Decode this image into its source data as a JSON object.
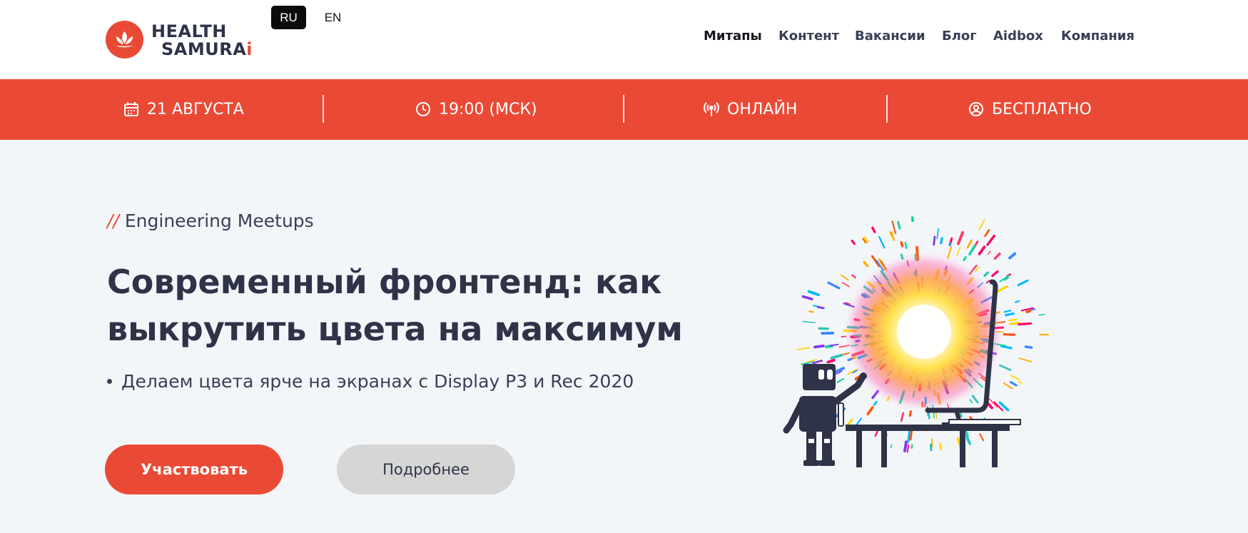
{
  "header": {
    "logo": {
      "line1": "HEALTH",
      "line2_main": "SAMURA",
      "line2_accent": "i"
    },
    "languages": [
      {
        "label": "RU",
        "active": true
      },
      {
        "label": "EN",
        "active": false
      }
    ],
    "nav": [
      {
        "label": "Митапы",
        "active": true
      },
      {
        "label": "Контент",
        "active": false
      },
      {
        "label": "Вакансии",
        "active": false
      },
      {
        "label": "Блог",
        "active": false
      },
      {
        "label": "Aidbox",
        "active": false
      },
      {
        "label": "Компания",
        "active": false
      }
    ]
  },
  "infobar": {
    "date": {
      "icon": "calendar-icon",
      "label": "21 АВГУСТА"
    },
    "time": {
      "icon": "clock-icon",
      "label": "19:00 (МСК)"
    },
    "format": {
      "icon": "broadcast-icon",
      "label": "ОНЛАЙН"
    },
    "price": {
      "icon": "user-circle-icon",
      "label": "БЕСПЛАТНО"
    }
  },
  "hero": {
    "eyebrow_mark": "//",
    "eyebrow": "Engineering Meetups",
    "title_line1": "Современный фронтенд: как",
    "title_line2": "выкрутить цвета на максимум",
    "bullets": [
      "Делаем цвета ярче на экранах с Display P3 и Rec 2020"
    ],
    "primary_button": "Участвовать",
    "secondary_button": "Подробнее",
    "illustration": "robot-pointing-at-colorful-monitor-illustration"
  },
  "colors": {
    "accent": "#ea4a35",
    "text_dark": "#2e3348",
    "page_bg": "#f3f6f9",
    "secondary_button_bg": "#d6d6d6"
  }
}
